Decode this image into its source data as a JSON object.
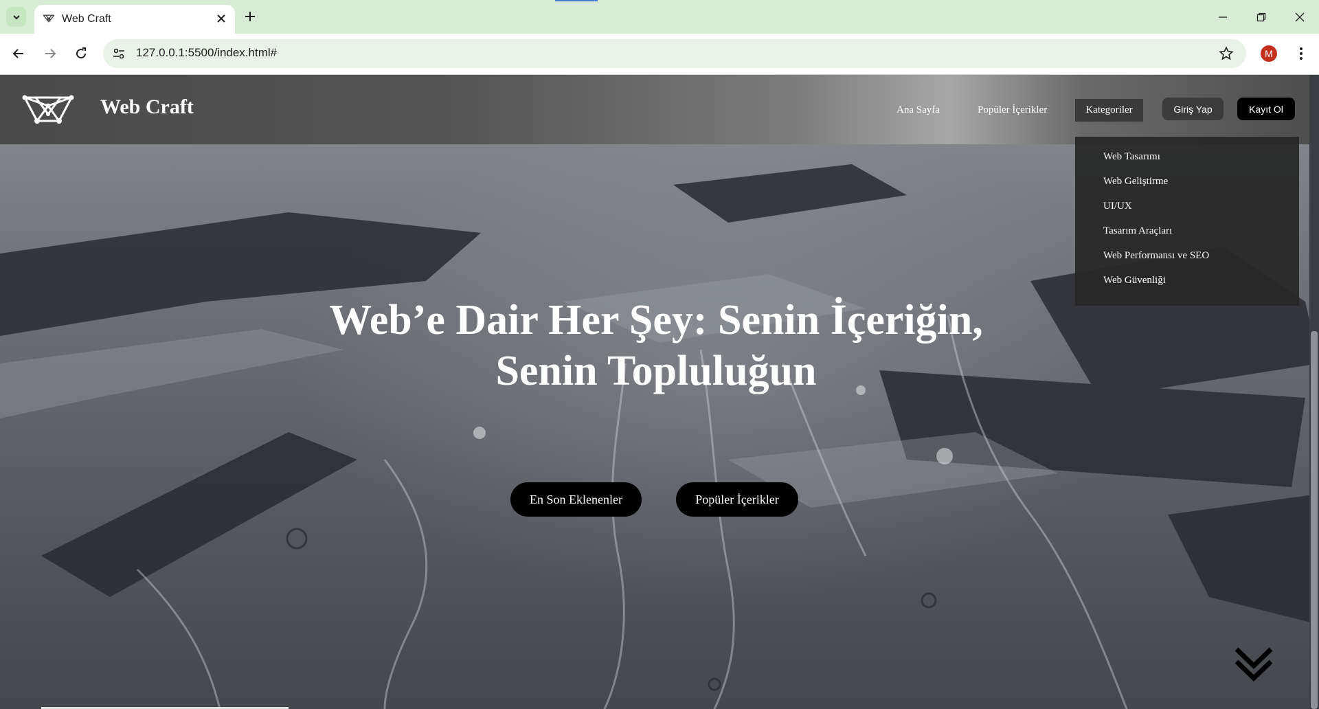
{
  "browser": {
    "tab_title": "Web Craft",
    "url": "127.0.0.1:5500/index.html#",
    "profile_initial": "M"
  },
  "site": {
    "brand": "Web Craft",
    "nav": {
      "home": "Ana Sayfa",
      "popular": "Popüler İçerikler",
      "categories": "Kategoriler",
      "login": "Giriş Yap",
      "signup": "Kayıt Ol"
    },
    "dropdown_items": [
      "Web Tasarımı",
      "Web Geliştirme",
      "UI/UX",
      "Tasarım Araçları",
      "Web Performansı ve SEO",
      "Web Güvenliği"
    ],
    "hero": {
      "title_line1": "Web’e Dair Her Şey: Senin İçeriğin,",
      "title_line2": "Senin Topluluğun",
      "button_latest": "En Son Eklenenler",
      "button_popular": "Popüler İçerikler"
    }
  },
  "icons": {
    "logo": "web-craft-logo-icon",
    "scroll": "double-chevron-down-icon"
  },
  "colors": {
    "chrome_tabstrip": "#d8ecd5",
    "header_dark": "#4a4a4a",
    "button_black": "#000000",
    "dropdown_bg": "#282828",
    "avatar": "#c5301e"
  }
}
